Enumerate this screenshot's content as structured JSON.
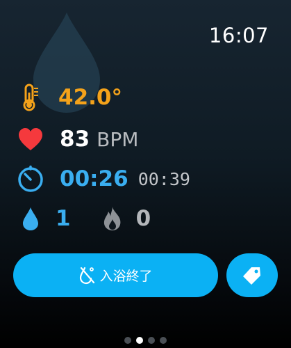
{
  "status": {
    "time": "16:07"
  },
  "metrics": {
    "temperature": {
      "value": "42.0°",
      "icon": "thermometer-icon",
      "color": "#f4a21a"
    },
    "heart_rate": {
      "value": "83",
      "unit": "BPM",
      "icon": "heart-icon",
      "color": "#f5393d"
    },
    "timer": {
      "elapsed": "00:26",
      "secondary": "00:39",
      "icon": "timer-icon",
      "color": "#3aaef0"
    },
    "water": {
      "value": "1",
      "icon": "water-drop-icon",
      "color": "#3aaef0"
    },
    "calories": {
      "value": "0",
      "icon": "flame-icon",
      "color": "#9fa3a8"
    }
  },
  "actions": {
    "end_bath_label": "入浴終了",
    "end_bath_icon": "bath-end-icon",
    "tag_icon": "tag-icon",
    "accent_color": "#0bb1f4"
  },
  "pagination": {
    "pages": 4,
    "active_index": 1
  }
}
